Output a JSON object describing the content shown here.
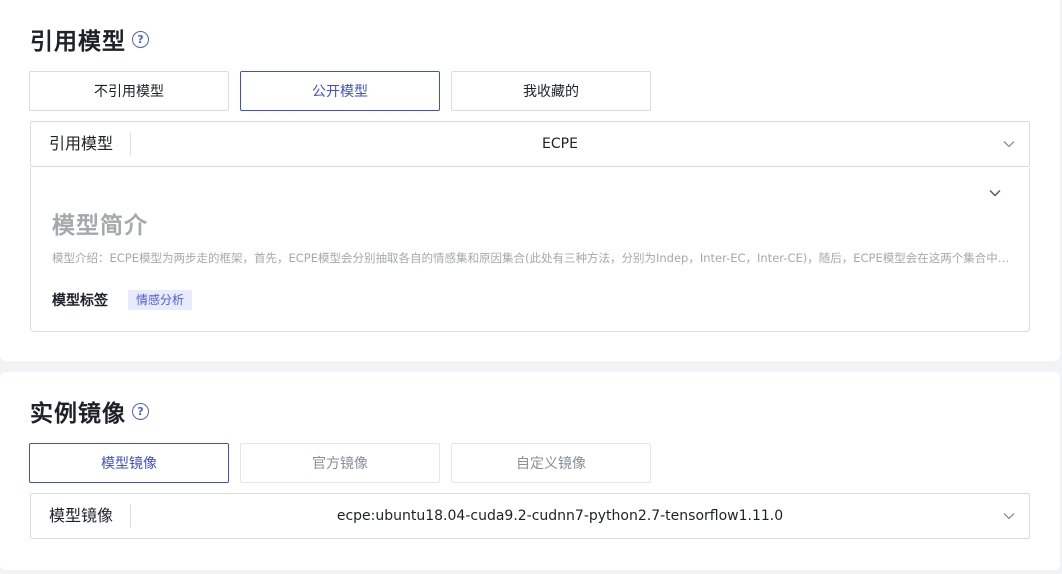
{
  "model_section": {
    "title": "引用模型",
    "tabs": [
      {
        "label": "不引用模型",
        "state": "default"
      },
      {
        "label": "公开模型",
        "state": "active"
      },
      {
        "label": "我收藏的",
        "state": "default"
      }
    ],
    "select": {
      "label": "引用模型",
      "value": "ECPE"
    },
    "panel": {
      "title": "模型简介",
      "description": "模型介绍：ECPE模型为两步走的框架，首先，ECPE模型会分别抽取各自的情感集和原因集合(此处有三种方法，分别为Indep，Inter-EC，Inter-CE)，随后，ECPE模型会在这两个集合中配对",
      "tag_label": "模型标签",
      "tags": [
        "情感分析"
      ]
    }
  },
  "image_section": {
    "title": "实例镜像",
    "tabs": [
      {
        "label": "模型镜像",
        "state": "active"
      },
      {
        "label": "官方镜像",
        "state": "disabled"
      },
      {
        "label": "自定义镜像",
        "state": "disabled"
      }
    ],
    "select": {
      "label": "模型镜像",
      "value": "ecpe:ubuntu18.04-cuda9.2-cudnn7-python2.7-tensorflow1.11.0"
    }
  },
  "icons": {
    "help": "question-circle-icon",
    "dropdown": "chevron-down-icon"
  },
  "colors": {
    "accent": "#3f4fd0",
    "tag_bg": "#e8ebfb",
    "muted": "#a6a8ad"
  }
}
